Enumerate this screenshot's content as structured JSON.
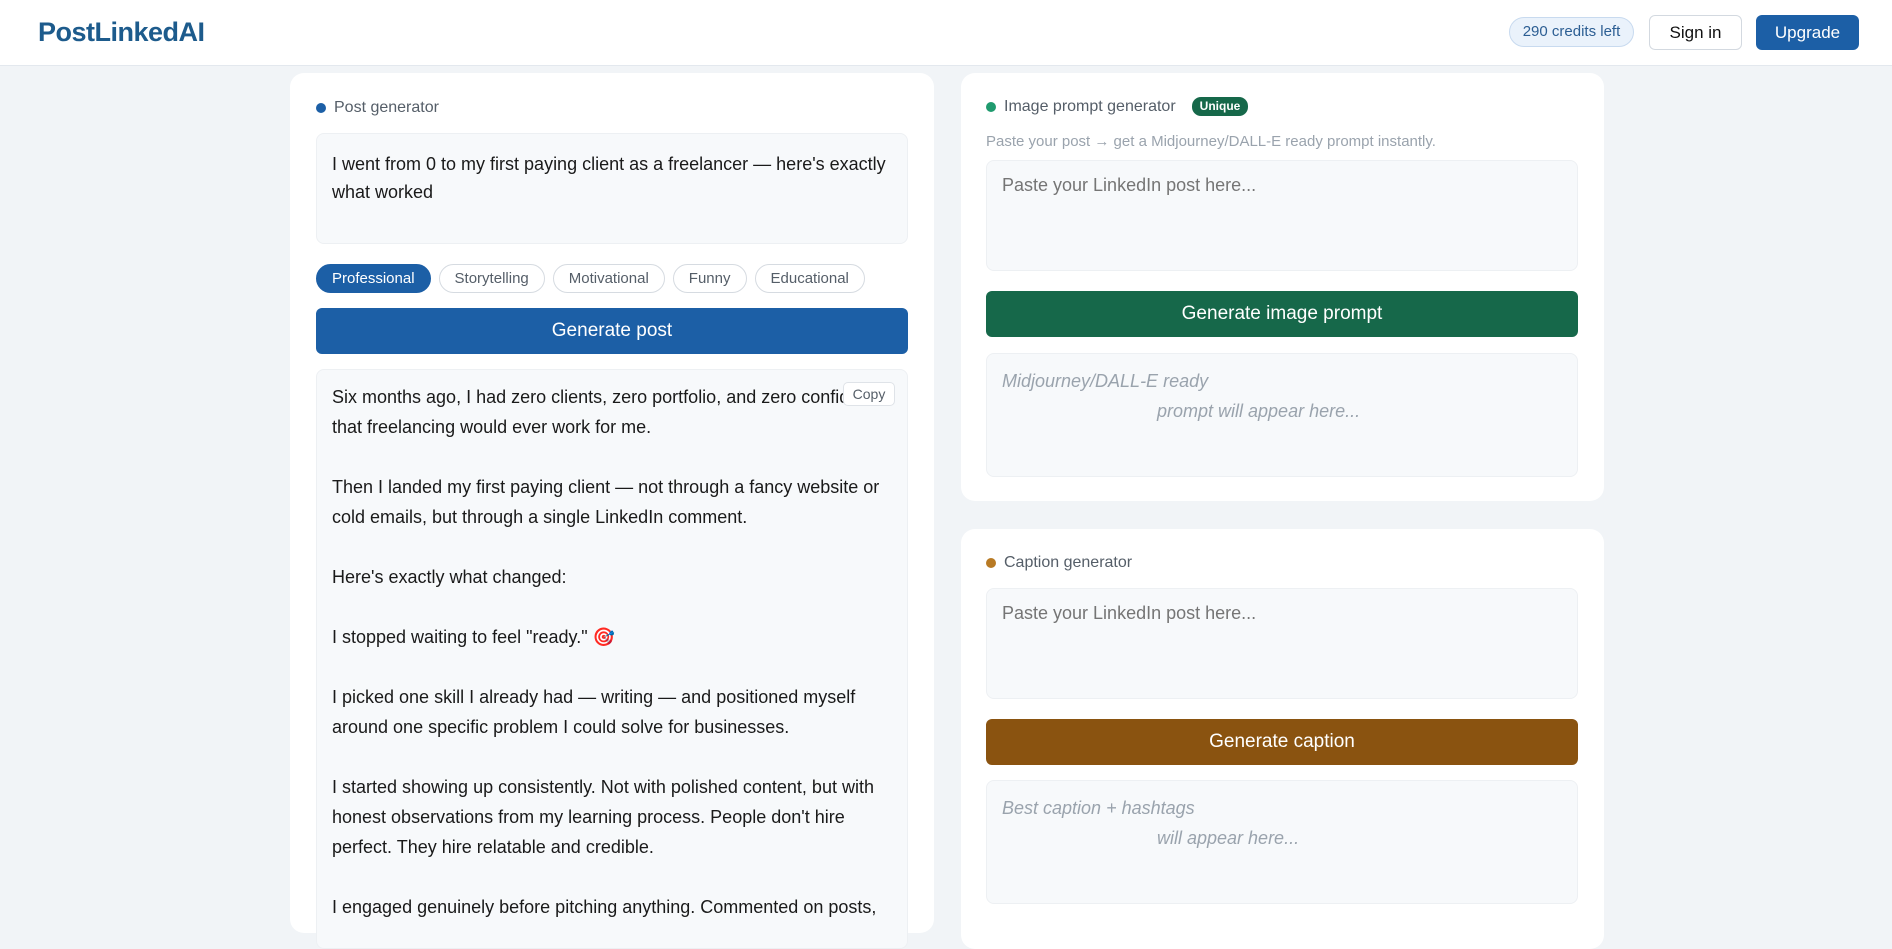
{
  "header": {
    "logo": "PostLinkedAI",
    "credits": "290 credits left",
    "signin_label": "Sign in",
    "upgrade_label": "Upgrade"
  },
  "post_generator": {
    "title": "Post generator",
    "dot_color": "#1c5fa6",
    "topic_value": "I went from 0 to my first paying client as a freelancer — here's exactly what worked",
    "tones": [
      {
        "label": "Professional",
        "active": true
      },
      {
        "label": "Storytelling",
        "active": false
      },
      {
        "label": "Motivational",
        "active": false
      },
      {
        "label": "Funny",
        "active": false
      },
      {
        "label": "Educational",
        "active": false
      }
    ],
    "generate_label": "Generate post",
    "copy_label": "Copy",
    "output": "Six months ago, I had zero clients, zero portfolio, and zero confidence that freelancing would ever work for me.\n\nThen I landed my first paying client — not through a fancy website or cold emails, but through a single LinkedIn comment.\n\nHere's exactly what changed:\n\nI stopped waiting to feel \"ready.\" 🎯\n\nI picked one skill I already had — writing — and positioned myself around one specific problem I could solve for businesses.\n\nI started showing up consistently. Not with polished content, but with honest observations from my learning process. People don't hire perfect. They hire relatable and credible.\n\nI engaged genuinely before pitching anything. Commented on posts,"
  },
  "image_prompt": {
    "title": "Image prompt generator",
    "dot_color": "#1f9a6e",
    "badge": "Unique",
    "hint": "Paste your post → get a Midjourney/DALL-E ready prompt instantly.",
    "input_placeholder": "Paste your LinkedIn post here...",
    "generate_label": "Generate image prompt",
    "result_line1": "Midjourney/DALL-E ready",
    "result_line2": "prompt will appear here..."
  },
  "caption": {
    "title": "Caption generator",
    "dot_color": "#b87a24",
    "input_placeholder": "Paste your LinkedIn post here...",
    "generate_label": "Generate caption",
    "result_line1": "Best caption + hashtags",
    "result_line2": "will appear here..."
  },
  "colors": {
    "primary": "#1c5fa6",
    "green": "#16684a",
    "brown": "#8a5310"
  }
}
